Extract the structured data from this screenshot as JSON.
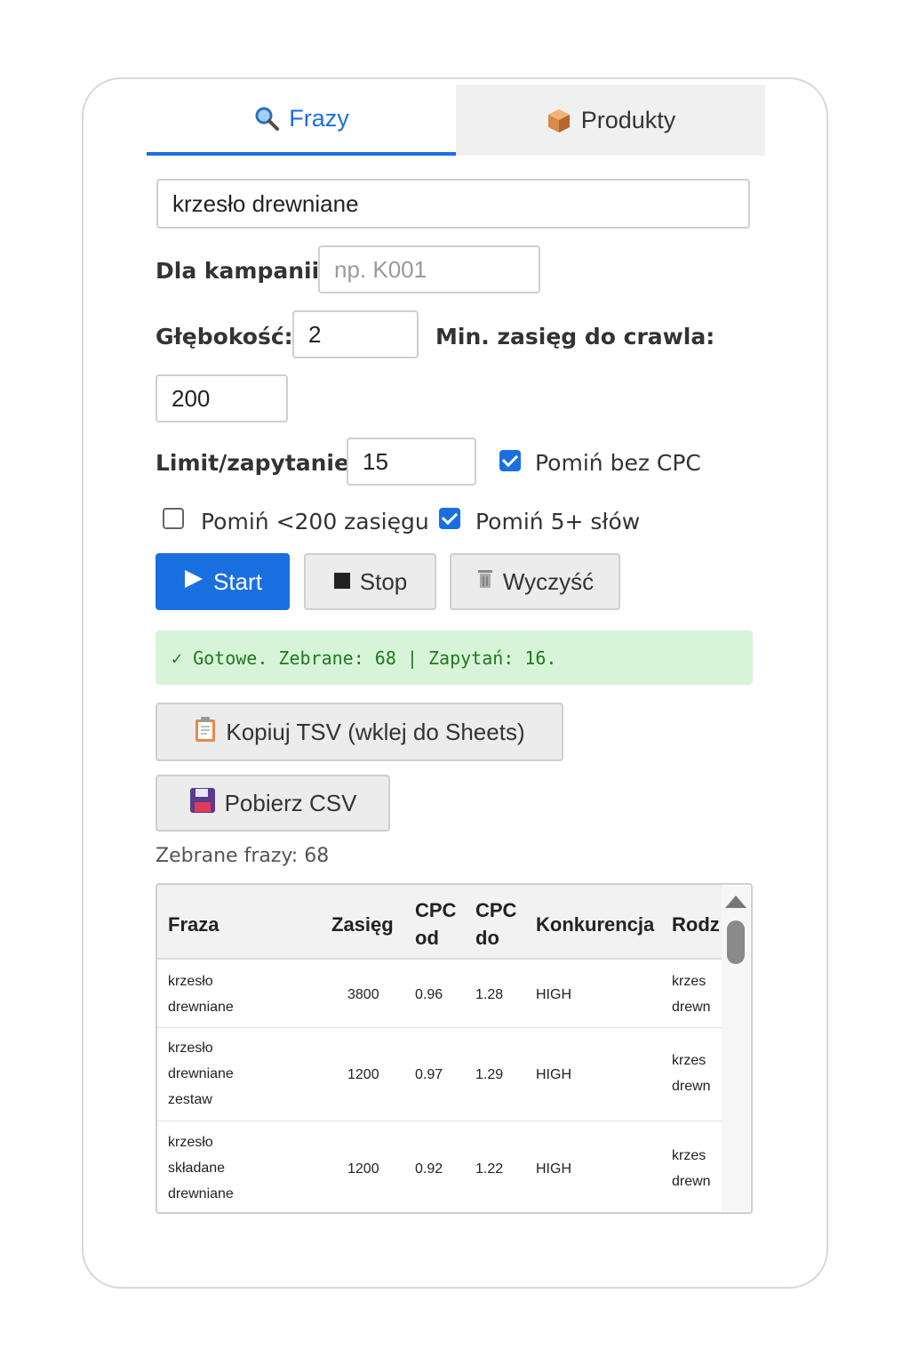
{
  "tabs": [
    {
      "label": "Frazy",
      "icon": "magnifier-icon",
      "active": true
    },
    {
      "label": "Produkty",
      "icon": "package-icon",
      "active": false
    }
  ],
  "search": {
    "value": "krzesło drewniane"
  },
  "campaign": {
    "label": "Dla kampanii:",
    "placeholder": "np. K001",
    "value": ""
  },
  "depth": {
    "label": "Głębokość:",
    "value": "2"
  },
  "min_reach": {
    "label": "Min. zasięg do crawla:",
    "value": "200"
  },
  "limit": {
    "label": "Limit/zapytanie:",
    "value": "15"
  },
  "checkboxes": {
    "skip_no_cpc": {
      "label": "Pomiń bez CPC",
      "checked": true
    },
    "skip_low_reach": {
      "label": "Pomiń <200 zasięgu",
      "checked": false
    },
    "skip_5_words": {
      "label": "Pomiń 5+ słów",
      "checked": true
    }
  },
  "buttons": {
    "start": "Start",
    "stop": "Stop",
    "clear": "Wyczyść",
    "copy_tsv": "Kopiuj TSV (wklej do Sheets)",
    "download_csv": "Pobierz CSV"
  },
  "status": {
    "text": "✓ Gotowe. Zebrane: 68 | Zapytań: 16.",
    "color": "#1d7a1d"
  },
  "collected": {
    "text": "Zebrane frazy: 68"
  },
  "table": {
    "headers": {
      "fraza": "Fraza",
      "zasieg": "Zasięg",
      "cpc_od": "CPC od",
      "cpc_do": "CPC do",
      "konkurencja": "Konkurencja",
      "rodzaj": "Rodz"
    },
    "rows": [
      {
        "fraza": "krzesło drewniane",
        "fraza_lines": [
          "krzesło",
          "drewniane"
        ],
        "zasieg": "3800",
        "cpc_od": "0.96",
        "cpc_do": "1.28",
        "konkurencja": "HIGH",
        "rodzaj_lines": [
          "krzes",
          "drewn"
        ]
      },
      {
        "fraza": "krzesło drewniane zestaw",
        "fraza_lines": [
          "krzesło",
          "drewniane",
          "zestaw"
        ],
        "zasieg": "1200",
        "cpc_od": "0.97",
        "cpc_do": "1.29",
        "konkurencja": "HIGH",
        "rodzaj_lines": [
          "krzes",
          "drewn"
        ]
      },
      {
        "fraza": "krzesło składane drewniane",
        "fraza_lines": [
          "krzesło",
          "składane",
          "drewniane"
        ],
        "zasieg": "1200",
        "cpc_od": "0.92",
        "cpc_do": "1.22",
        "konkurencja": "HIGH",
        "rodzaj_lines": [
          "krzes",
          "drewn"
        ]
      }
    ]
  },
  "colors": {
    "accent": "#1a6fe0",
    "status_bg": "#d8f4d8"
  }
}
